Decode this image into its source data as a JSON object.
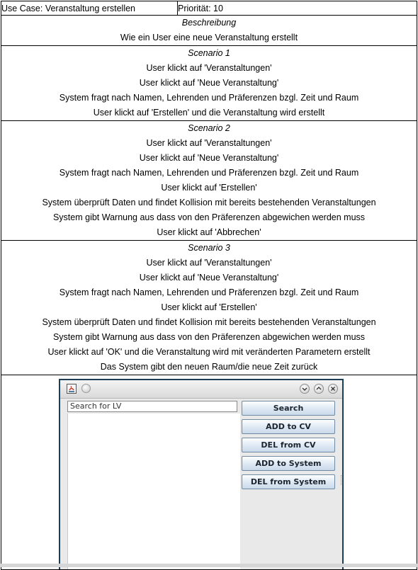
{
  "header": {
    "use_case": "Use Case: Veranstaltung erstellen",
    "priority": "Priorität: 10"
  },
  "description": {
    "title": "Beschreibung",
    "text": "Wie ein User eine neue Veranstaltung erstellt"
  },
  "scenarios": [
    {
      "title": "Scenario 1",
      "lines": [
        "User klickt auf 'Veranstaltungen'",
        "User klickt auf 'Neue Veranstaltung'",
        "System fragt nach Namen, Lehrenden und Präferenzen bzgl. Zeit und Raum",
        "User klickt auf 'Erstellen' und die Veranstaltung wird erstellt"
      ]
    },
    {
      "title": "Scenario 2",
      "lines": [
        "User klickt auf 'Veranstaltungen'",
        "User klickt auf 'Neue Veranstaltung'",
        "System fragt nach Namen, Lehrenden und Präferenzen bzgl. Zeit und Raum",
        "User klickt auf 'Erstellen'",
        "System überprüft Daten und findet Kollision mit bereits bestehenden Veranstaltungen",
        "System gibt Warnung aus dass von den Präferenzen abgewichen werden muss",
        "User klickt auf 'Abbrechen'"
      ]
    },
    {
      "title": "Scenario 3",
      "lines": [
        "User klickt auf 'Veranstaltungen'",
        "User klickt auf 'Neue Veranstaltung'",
        "System fragt nach Namen, Lehrenden und Präferenzen bzgl. Zeit und Raum",
        "User klickt auf 'Erstellen'",
        "System überprüft Daten und findet Kollision mit bereits bestehenden Veranstaltungen",
        "System gibt Warnung aus dass von den Präferenzen abgewichen werden muss",
        "User klickt auf 'OK' und die Veranstaltung wird mit veränderten Parametern erstellt",
        "Das System gibt den neuen Raum/die neue Zeit zurück"
      ]
    }
  ],
  "window": {
    "search_value": "Search for LV",
    "buttons": [
      "Search",
      "ADD to CV",
      "DEL from CV",
      "ADD to System",
      "DEL from System"
    ]
  }
}
